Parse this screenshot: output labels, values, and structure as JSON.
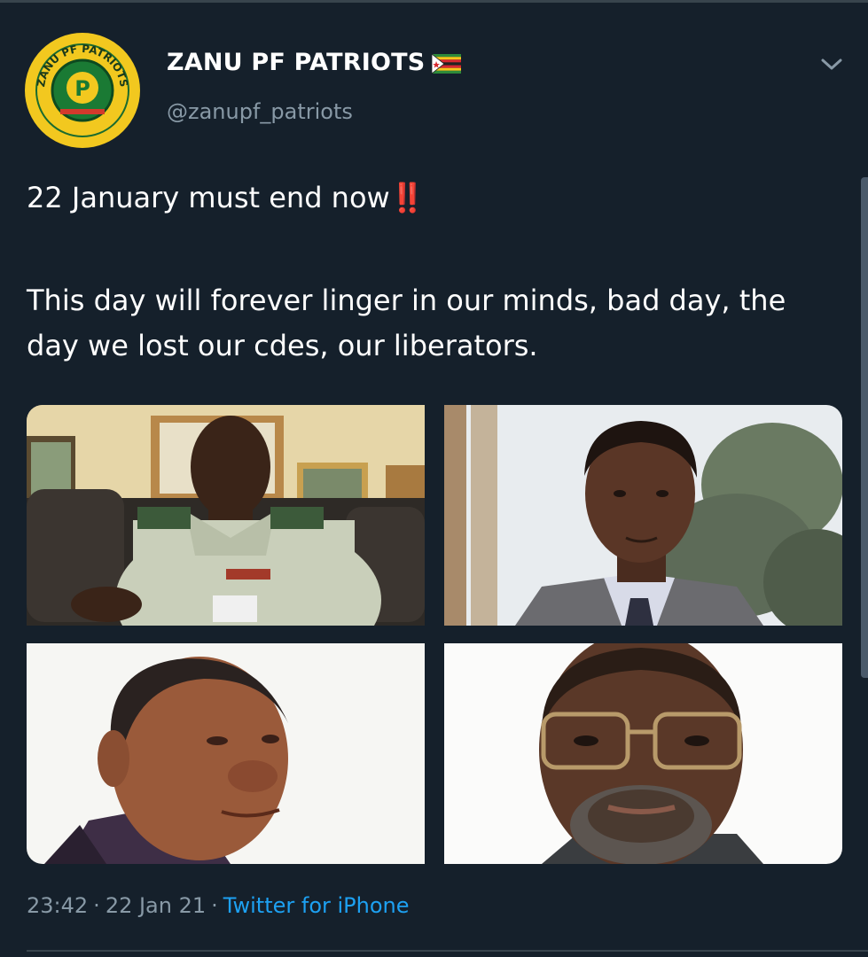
{
  "tweet": {
    "author": {
      "display_name": "ZANU PF PATRIOTS",
      "handle": "@zanupf_patriots",
      "badge_icon": "zimbabwe-flag-icon",
      "avatar_logo_text": "ZANU PF PATRIOTS"
    },
    "text_line1": "22 January must end now",
    "text_line1_emoji": "‼️",
    "text_line2": "This day will forever linger in our minds, bad day, the day we lost our cdes, our liberators.",
    "media": [
      {
        "name": "photo-1",
        "description_icon": "photo-icon"
      },
      {
        "name": "photo-2",
        "description_icon": "photo-icon"
      },
      {
        "name": "photo-3",
        "description_icon": "photo-icon"
      },
      {
        "name": "photo-4",
        "description_icon": "photo-icon"
      }
    ],
    "time": "23:42",
    "date": "22 Jan 21",
    "source": "Twitter for iPhone",
    "separator": "·",
    "menu_icon": "chevron-down-icon"
  },
  "colors": {
    "background": "#15202b",
    "text_primary": "#ffffff",
    "text_secondary": "#8899a6",
    "link": "#1da1f2",
    "divider": "#38444d",
    "avatar_bg": "#f2c81f",
    "emoji_red": "#e0245e"
  }
}
